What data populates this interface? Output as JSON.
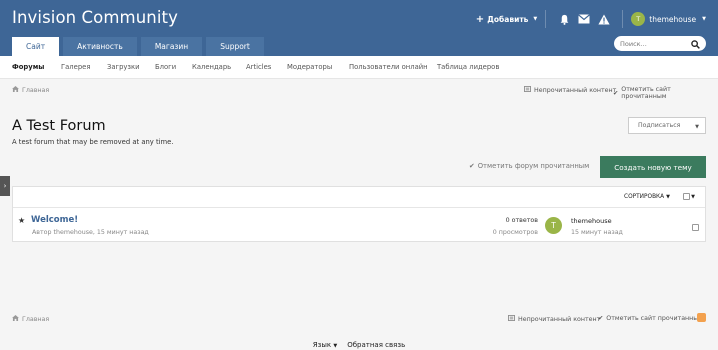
{
  "header": {
    "title": "Invision Community",
    "add_label": "Добавить",
    "username": "themehouse",
    "avatar_letter": "T"
  },
  "tabs": [
    {
      "label": "Сайт"
    },
    {
      "label": "Активность"
    },
    {
      "label": "Магазин"
    },
    {
      "label": "Support"
    }
  ],
  "search": {
    "placeholder": "Поиск..."
  },
  "subnav": [
    {
      "label": "Форумы"
    },
    {
      "label": "Галерея"
    },
    {
      "label": "Загрузки"
    },
    {
      "label": "Блоги"
    },
    {
      "label": "Календарь"
    },
    {
      "label": "Articles"
    },
    {
      "label": "Модераторы"
    },
    {
      "label": "Пользователи онлайн"
    },
    {
      "label": "Таблица лидеров"
    }
  ],
  "breadcrumb": {
    "home": "Главная",
    "unread": "Непрочитанный контент",
    "mark_read": "Отметить сайт прочитанным"
  },
  "forum": {
    "title": "A Test Forum",
    "description": "A test forum that may be removed at any time.",
    "follow": "Подписаться",
    "mark_forum": "Отметить форум прочитанным",
    "new_topic": "Создать новую тему",
    "sort": "СОРТИРОВКА"
  },
  "topic": {
    "title": "Welcome!",
    "meta": "Автор themehouse, 15 минут назад",
    "replies": "0 ответов",
    "views": "0 просмотров",
    "last_avatar": "T",
    "last_user": "themehouse",
    "last_time": "15 минут назад"
  },
  "footer": {
    "language": "Язык",
    "feedback": "Обратная связь"
  },
  "colors": {
    "header": "#3e6696",
    "new_topic": "#3b7b5e",
    "avatar": "#9ab548"
  }
}
